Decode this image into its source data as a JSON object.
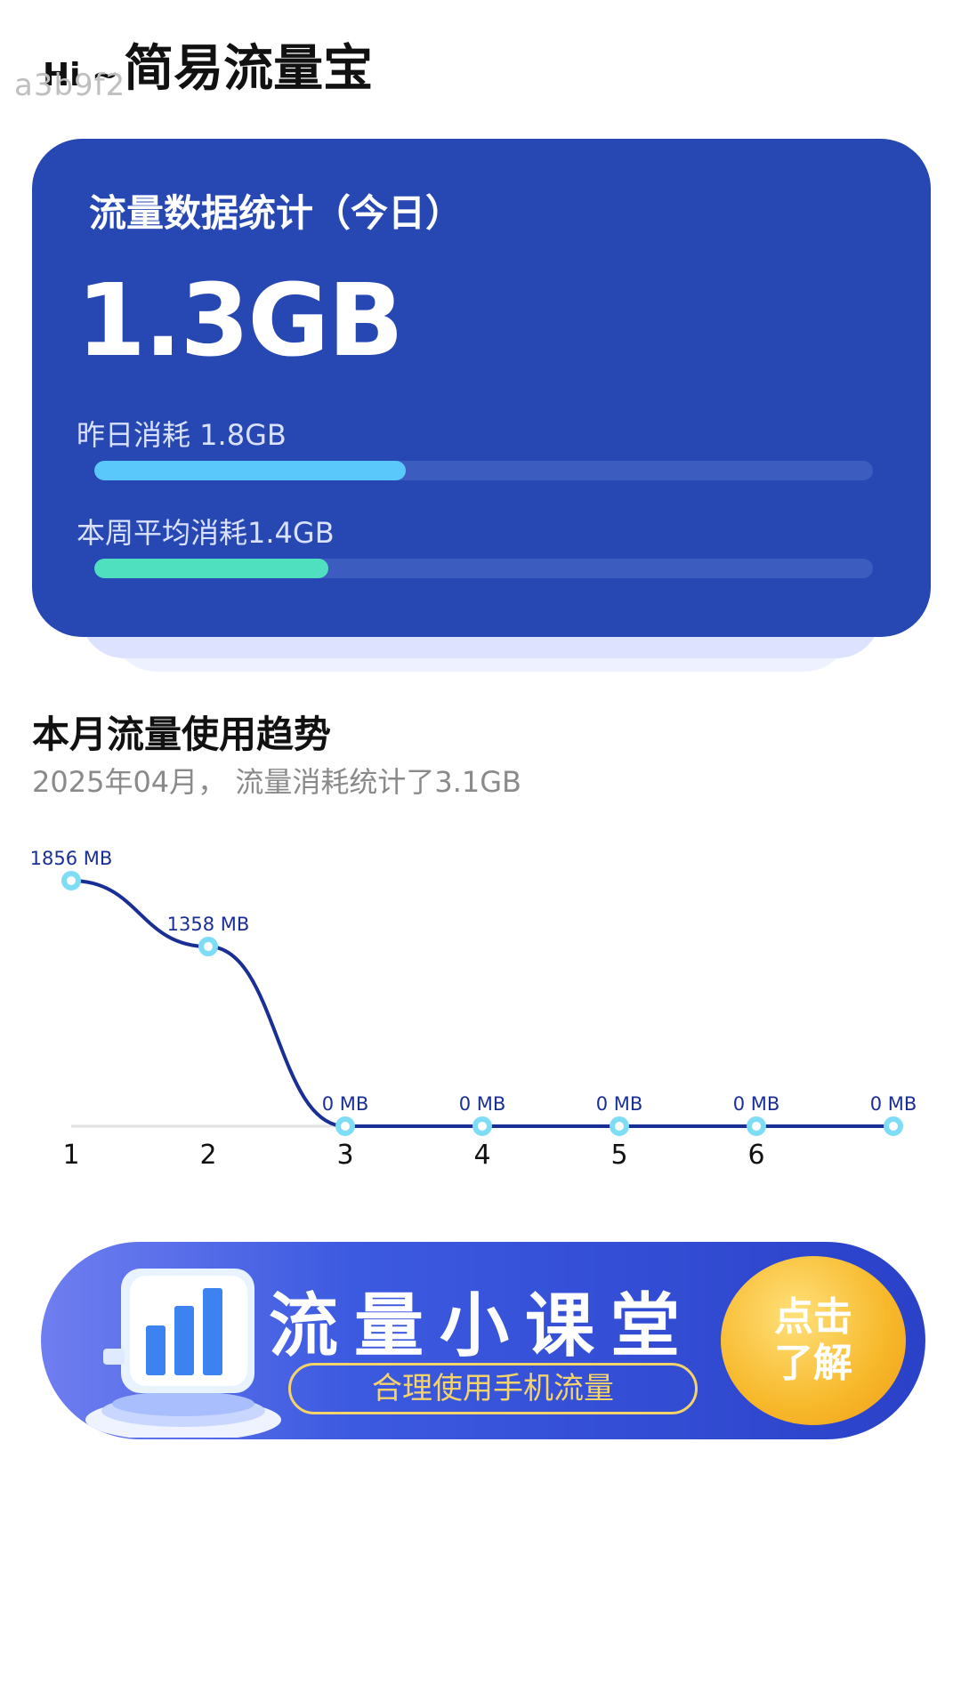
{
  "header": {
    "greeting": "Hi ~",
    "app_name": "简易流量宝",
    "watermark": "a3b9f2"
  },
  "stats": {
    "title": "流量数据统计（今日）",
    "today_value": "1.3GB",
    "yesterday_label": "昨日消耗 1.8GB",
    "yesterday_progress": 0.4,
    "weekly_label": "本周平均消耗1.4GB",
    "weekly_progress": 0.3,
    "colors": {
      "card": "#2747b3",
      "bar1": "#5ac8fa",
      "bar2": "#4fe0c0"
    }
  },
  "month": {
    "title": "本月流量使用趋势",
    "subtitle": "2025年04月， 流量消耗统计了3.1GB"
  },
  "chart_data": {
    "type": "line",
    "x": [
      "1",
      "2",
      "3",
      "4",
      "5",
      "6",
      ""
    ],
    "values": [
      1856,
      1358,
      0,
      0,
      0,
      0,
      0
    ],
    "data_labels": [
      "1856 MB",
      "1358 MB",
      "0 MB",
      "0 MB",
      "0 MB",
      "0 MB",
      "0 MB"
    ],
    "ylim": [
      0,
      1856
    ],
    "line_color": "#1a2f95",
    "point_color": "#7fdcf5"
  },
  "banner": {
    "title": "流量小课堂",
    "subtitle": "合理使用手机流量",
    "cta": "点击了解"
  }
}
